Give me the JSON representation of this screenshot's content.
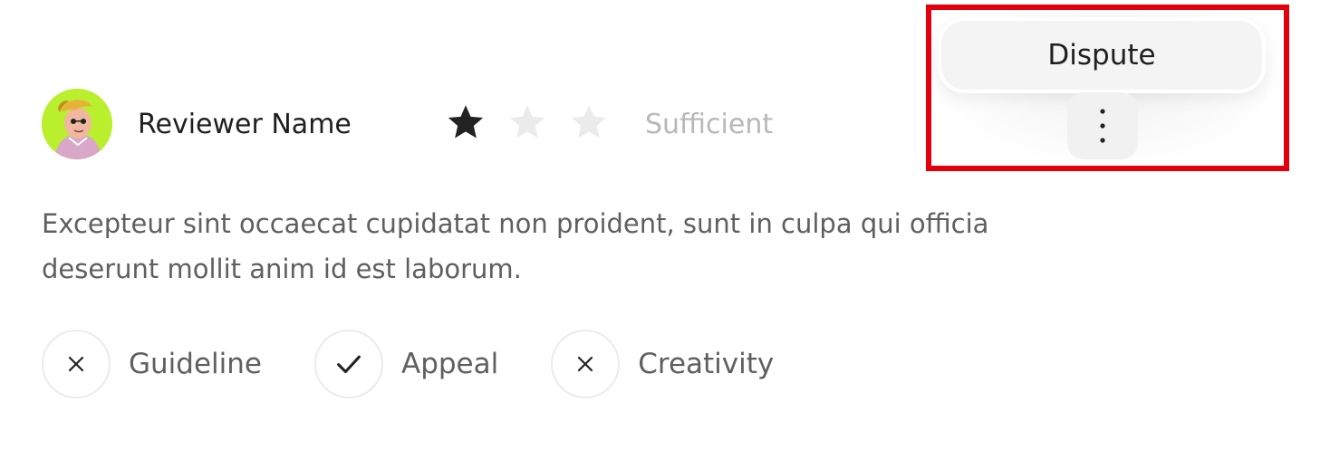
{
  "reviewer": {
    "name": "Reviewer Name",
    "avatar_icon": "cartoon-avatar"
  },
  "rating": {
    "value": 1,
    "max": 3,
    "label": "Sufficient",
    "filled_color": "#222222",
    "empty_color": "#ebebeb"
  },
  "review": {
    "text": "Excepteur sint occaecat cupidatat non proident, sunt in culpa qui officia deserunt mollit anim id est laborum."
  },
  "criteria": [
    {
      "label": "Guideline",
      "status": "fail",
      "icon": "x-icon"
    },
    {
      "label": "Appeal",
      "status": "pass",
      "icon": "check-icon"
    },
    {
      "label": "Creativity",
      "status": "fail",
      "icon": "x-icon"
    }
  ],
  "menu": {
    "dispute_label": "Dispute",
    "more_icon": "vertical-dots-icon"
  },
  "highlight": {
    "color": "#e2000d"
  }
}
